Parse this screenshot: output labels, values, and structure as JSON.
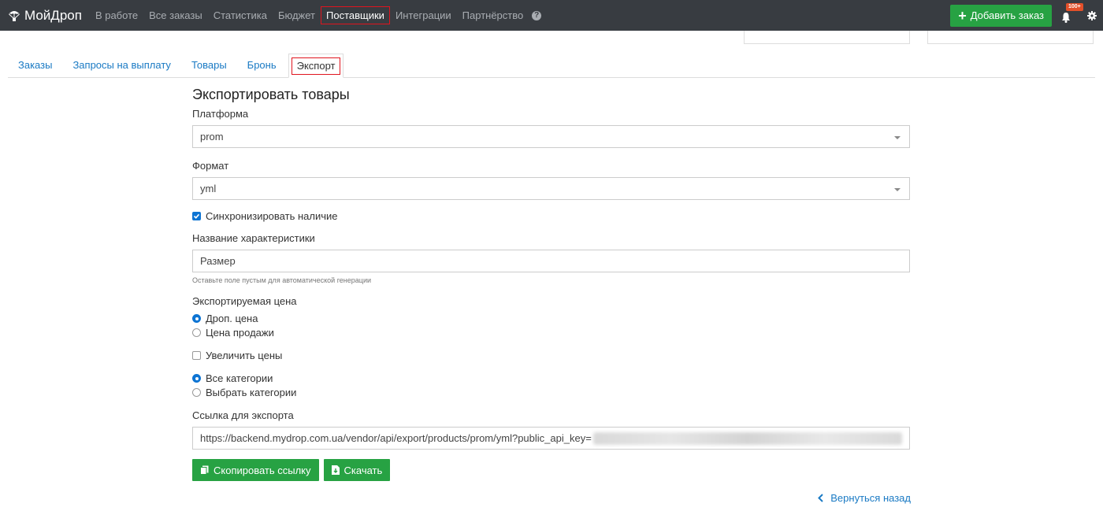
{
  "nav": {
    "brand": "МойДроп",
    "links": [
      "В работе",
      "Все заказы",
      "Статистика",
      "Бюджет",
      "Поставщики",
      "Интеграции",
      "Партнёрство"
    ],
    "active_link": "Поставщики",
    "add_order_label": "Добавить заказ",
    "notification_badge": "100+"
  },
  "tabs": [
    "Заказы",
    "Запросы на выплату",
    "Товары",
    "Бронь",
    "Экспорт"
  ],
  "active_tab": "Экспорт",
  "form": {
    "title": "Экспортировать товары",
    "platform_label": "Платформа",
    "platform_value": "prom",
    "format_label": "Формат",
    "format_value": "yml",
    "sync_label": "Синхронизировать наличие",
    "sync_checked": true,
    "characteristic_label": "Название характеристики",
    "characteristic_placeholder": "Размер",
    "characteristic_help": "Оставьте поле пустым для автоматической генерации",
    "price_label": "Экспортируемая цена",
    "price_options": [
      "Дроп. цена",
      "Цена продажи"
    ],
    "price_selected": "Дроп. цена",
    "increase_prices_label": "Увеличить цены",
    "increase_prices_checked": false,
    "category_options": [
      "Все категории",
      "Выбрать категории"
    ],
    "category_selected": "Все категории",
    "export_link_label": "Ссылка для экспорта",
    "export_link_value": "https://backend.mydrop.com.ua/vendor/api/export/products/prom/yml?public_api_key=",
    "copy_button": "Скопировать ссылку",
    "download_button": "Скачать",
    "back_link": "Вернуться назад"
  },
  "colors": {
    "navbar_bg": "#383c41",
    "accent_green": "#27a243",
    "link_blue": "#1a7ac4",
    "highlight_red": "#e0141e",
    "check_blue": "#0d74d3"
  }
}
